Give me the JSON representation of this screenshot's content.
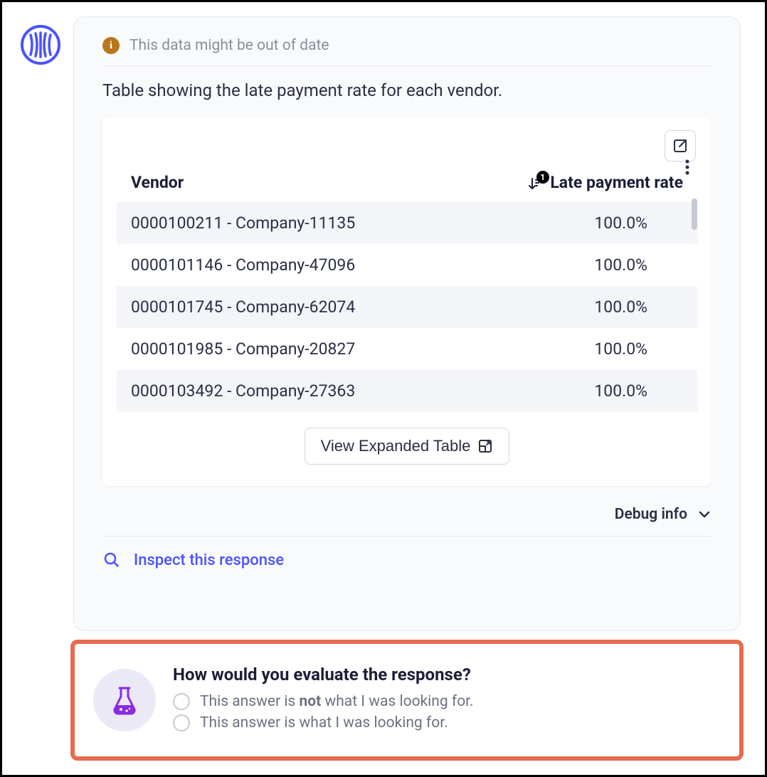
{
  "warning": {
    "text": "This data might be out of date"
  },
  "description": "Table showing the late payment rate for each vendor.",
  "table": {
    "headers": {
      "vendor": "Vendor",
      "rate": "Late payment rate"
    },
    "sort_badge": "1",
    "rows": [
      {
        "vendor": "0000100211 - Company-11135",
        "rate": "100.0%"
      },
      {
        "vendor": "0000101146 - Company-47096",
        "rate": "100.0%"
      },
      {
        "vendor": "0000101745 - Company-62074",
        "rate": "100.0%"
      },
      {
        "vendor": "0000101985 - Company-20827",
        "rate": "100.0%"
      },
      {
        "vendor": "0000103492 - Company-27363",
        "rate": "100.0%"
      }
    ]
  },
  "buttons": {
    "view_expanded": "View Expanded Table",
    "debug_info": "Debug info",
    "inspect": "Inspect this response"
  },
  "feedback": {
    "title": "How would you evaluate the response?",
    "option_not_prefix": "This answer is ",
    "option_not_bold": "not",
    "option_not_suffix": " what I was looking for.",
    "option_yes": "This answer is what I was looking for."
  }
}
